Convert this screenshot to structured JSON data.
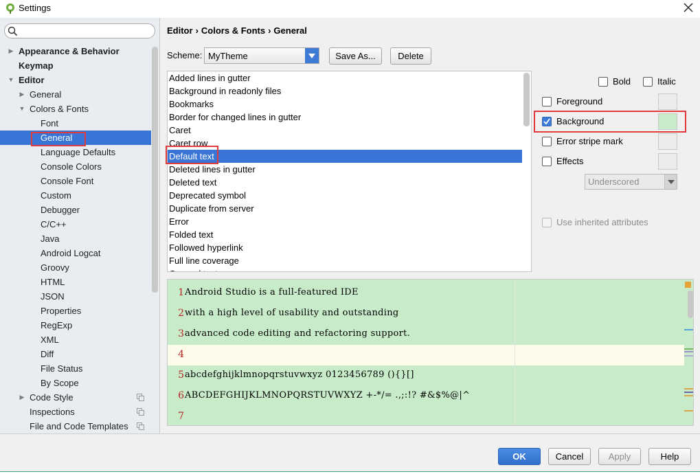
{
  "window": {
    "title": "Settings"
  },
  "search": {
    "placeholder": ""
  },
  "tree": [
    {
      "label": "Appearance & Behavior",
      "bold": true,
      "arrow": "▶",
      "selected": false,
      "copy": false
    },
    {
      "label": "Keymap",
      "bold": true,
      "arrow": "",
      "selected": false,
      "copy": false
    },
    {
      "label": "Editor",
      "bold": true,
      "arrow": "▼",
      "selected": false,
      "copy": false
    },
    {
      "label": "General",
      "bold": false,
      "arrow": "▶",
      "selected": false,
      "copy": false
    },
    {
      "label": "Colors & Fonts",
      "bold": false,
      "arrow": "▼",
      "selected": false,
      "copy": false
    },
    {
      "label": "Font",
      "bold": false,
      "arrow": "",
      "selected": false,
      "copy": false
    },
    {
      "label": "General",
      "bold": false,
      "arrow": "",
      "selected": true,
      "copy": false
    },
    {
      "label": "Language Defaults",
      "bold": false,
      "arrow": "",
      "selected": false,
      "copy": false
    },
    {
      "label": "Console Colors",
      "bold": false,
      "arrow": "",
      "selected": false,
      "copy": false
    },
    {
      "label": "Console Font",
      "bold": false,
      "arrow": "",
      "selected": false,
      "copy": false
    },
    {
      "label": "Custom",
      "bold": false,
      "arrow": "",
      "selected": false,
      "copy": false
    },
    {
      "label": "Debugger",
      "bold": false,
      "arrow": "",
      "selected": false,
      "copy": false
    },
    {
      "label": "C/C++",
      "bold": false,
      "arrow": "",
      "selected": false,
      "copy": false
    },
    {
      "label": "Java",
      "bold": false,
      "arrow": "",
      "selected": false,
      "copy": false
    },
    {
      "label": "Android Logcat",
      "bold": false,
      "arrow": "",
      "selected": false,
      "copy": false
    },
    {
      "label": "Groovy",
      "bold": false,
      "arrow": "",
      "selected": false,
      "copy": false
    },
    {
      "label": "HTML",
      "bold": false,
      "arrow": "",
      "selected": false,
      "copy": false
    },
    {
      "label": "JSON",
      "bold": false,
      "arrow": "",
      "selected": false,
      "copy": false
    },
    {
      "label": "Properties",
      "bold": false,
      "arrow": "",
      "selected": false,
      "copy": false
    },
    {
      "label": "RegExp",
      "bold": false,
      "arrow": "",
      "selected": false,
      "copy": false
    },
    {
      "label": "XML",
      "bold": false,
      "arrow": "",
      "selected": false,
      "copy": false
    },
    {
      "label": "Diff",
      "bold": false,
      "arrow": "",
      "selected": false,
      "copy": false
    },
    {
      "label": "File Status",
      "bold": false,
      "arrow": "",
      "selected": false,
      "copy": false
    },
    {
      "label": "By Scope",
      "bold": false,
      "arrow": "",
      "selected": false,
      "copy": false
    },
    {
      "label": "Code Style",
      "bold": false,
      "arrow": "▶",
      "selected": false,
      "copy": true
    },
    {
      "label": "Inspections",
      "bold": false,
      "arrow": "",
      "selected": false,
      "copy": true
    },
    {
      "label": "File and Code Templates",
      "bold": false,
      "arrow": "",
      "selected": false,
      "copy": true
    }
  ],
  "breadcrumb": {
    "part1": "Editor",
    "part2": "Colors & Fonts",
    "part3": "General",
    "sep": "›"
  },
  "scheme": {
    "label": "Scheme:",
    "value": "MyTheme",
    "save_as": "Save As...",
    "delete": "Delete"
  },
  "attributes": [
    "Added lines in gutter",
    "Background in readonly files",
    "Bookmarks",
    "Border for changed lines in gutter",
    "Caret",
    "Caret row",
    "Default text",
    "Deleted lines in gutter",
    "Deleted text",
    "Deprecated symbol",
    "Duplicate from server",
    "Error",
    "Folded text",
    "Followed hyperlink",
    "Full line coverage",
    "General text"
  ],
  "selected_attribute_index": 6,
  "options": {
    "bold": {
      "label": "Bold",
      "checked": false
    },
    "italic": {
      "label": "Italic",
      "checked": false
    },
    "foreground": {
      "label": "Foreground",
      "checked": false,
      "swatch": "#ececec"
    },
    "background": {
      "label": "Background",
      "checked": true,
      "swatch": "#c8ecc9"
    },
    "error_stripe": {
      "label": "Error stripe mark",
      "checked": false,
      "swatch": "#ececec"
    },
    "effects": {
      "label": "Effects",
      "checked": false,
      "swatch": "#ececec"
    },
    "effect_type": "Underscored",
    "inherited": {
      "label": "Use inherited attributes",
      "checked": false
    }
  },
  "preview": {
    "lines": [
      {
        "num": "1",
        "text": "Android Studio is a full-featured IDE"
      },
      {
        "num": "2",
        "text": "with a high level of usability and outstanding"
      },
      {
        "num": "3",
        "text": "advanced code editing and refactoring support."
      },
      {
        "num": "4",
        "text": ""
      },
      {
        "num": "5",
        "text": "abcdefghijklmnopqrstuvwxyz 0123456789 (){}[]"
      },
      {
        "num": "6",
        "text": "ABCDEFGHIJKLMNOPQRSTUVWXYZ +-*/= .,;:!? #&$%@|^"
      },
      {
        "num": "7",
        "text": ""
      }
    ],
    "background": "#c8ecc9",
    "caret_row_color": "#fdfcea"
  },
  "footer": {
    "ok": "OK",
    "cancel": "Cancel",
    "apply": "Apply",
    "help": "Help"
  },
  "colors": {
    "accent": "#3875d7",
    "highlight_box": "#e03a3a"
  }
}
